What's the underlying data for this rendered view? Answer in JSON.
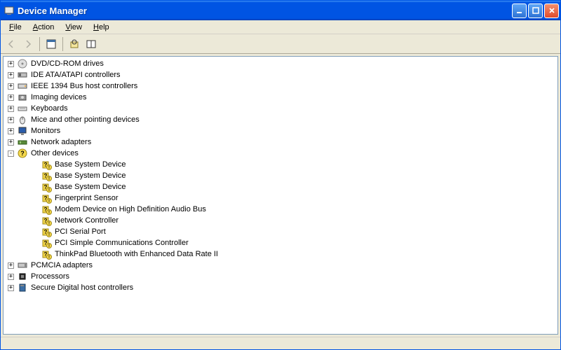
{
  "window": {
    "title": "Device Manager"
  },
  "menu": {
    "file": "File",
    "action": "Action",
    "view": "View",
    "help": "Help"
  },
  "tree": {
    "categories": [
      {
        "label": "DVD/CD-ROM drives",
        "icon": "disc"
      },
      {
        "label": "IDE ATA/ATAPI controllers",
        "icon": "ide"
      },
      {
        "label": "IEEE 1394 Bus host controllers",
        "icon": "ieee"
      },
      {
        "label": "Imaging devices",
        "icon": "imaging"
      },
      {
        "label": "Keyboards",
        "icon": "keyboard"
      },
      {
        "label": "Mice and other pointing devices",
        "icon": "mouse"
      },
      {
        "label": "Monitors",
        "icon": "monitor"
      },
      {
        "label": "Network adapters",
        "icon": "network"
      }
    ],
    "other_devices_label": "Other devices",
    "other_devices": [
      {
        "label": "Base System Device"
      },
      {
        "label": "Base System Device"
      },
      {
        "label": "Base System Device"
      },
      {
        "label": "Fingerprint Sensor"
      },
      {
        "label": "Modem Device on High Definition Audio Bus"
      },
      {
        "label": "Network Controller"
      },
      {
        "label": "PCI Serial Port"
      },
      {
        "label": "PCI Simple Communications Controller"
      },
      {
        "label": "ThinkPad Bluetooth with Enhanced Data Rate II"
      }
    ],
    "categories_after": [
      {
        "label": "PCMCIA adapters",
        "icon": "pcmcia"
      },
      {
        "label": "Processors",
        "icon": "cpu"
      },
      {
        "label": "Secure Digital host controllers",
        "icon": "sd"
      }
    ]
  }
}
